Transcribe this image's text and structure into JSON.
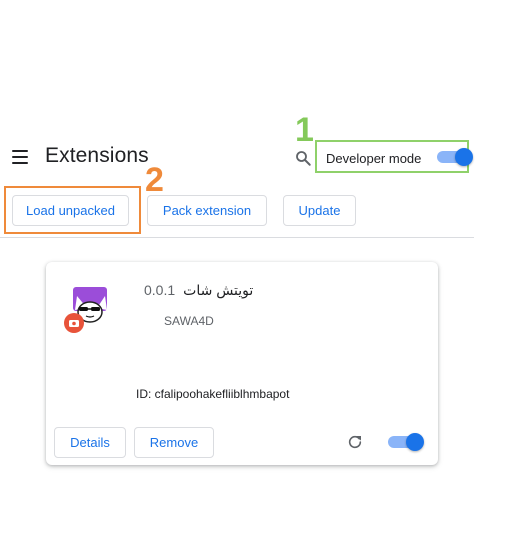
{
  "header": {
    "title": "Extensions",
    "developer_mode_label": "Developer mode",
    "developer_mode_on": true
  },
  "annotations": {
    "step1": "1",
    "step2": "2"
  },
  "toolbar": {
    "load_unpacked": "Load unpacked",
    "pack_extension": "Pack extension",
    "update": "Update"
  },
  "extension": {
    "version": "0.0.1",
    "name": "تويتش شات",
    "author": "SAWA4D",
    "id_text": "ID: cfalipoohakefliiblhmbapot",
    "details_label": "Details",
    "remove_label": "Remove",
    "enabled": true
  },
  "colors": {
    "accent": "#1a73e8",
    "annotation_green": "#84c95a",
    "annotation_orange": "#ef8a3a"
  }
}
